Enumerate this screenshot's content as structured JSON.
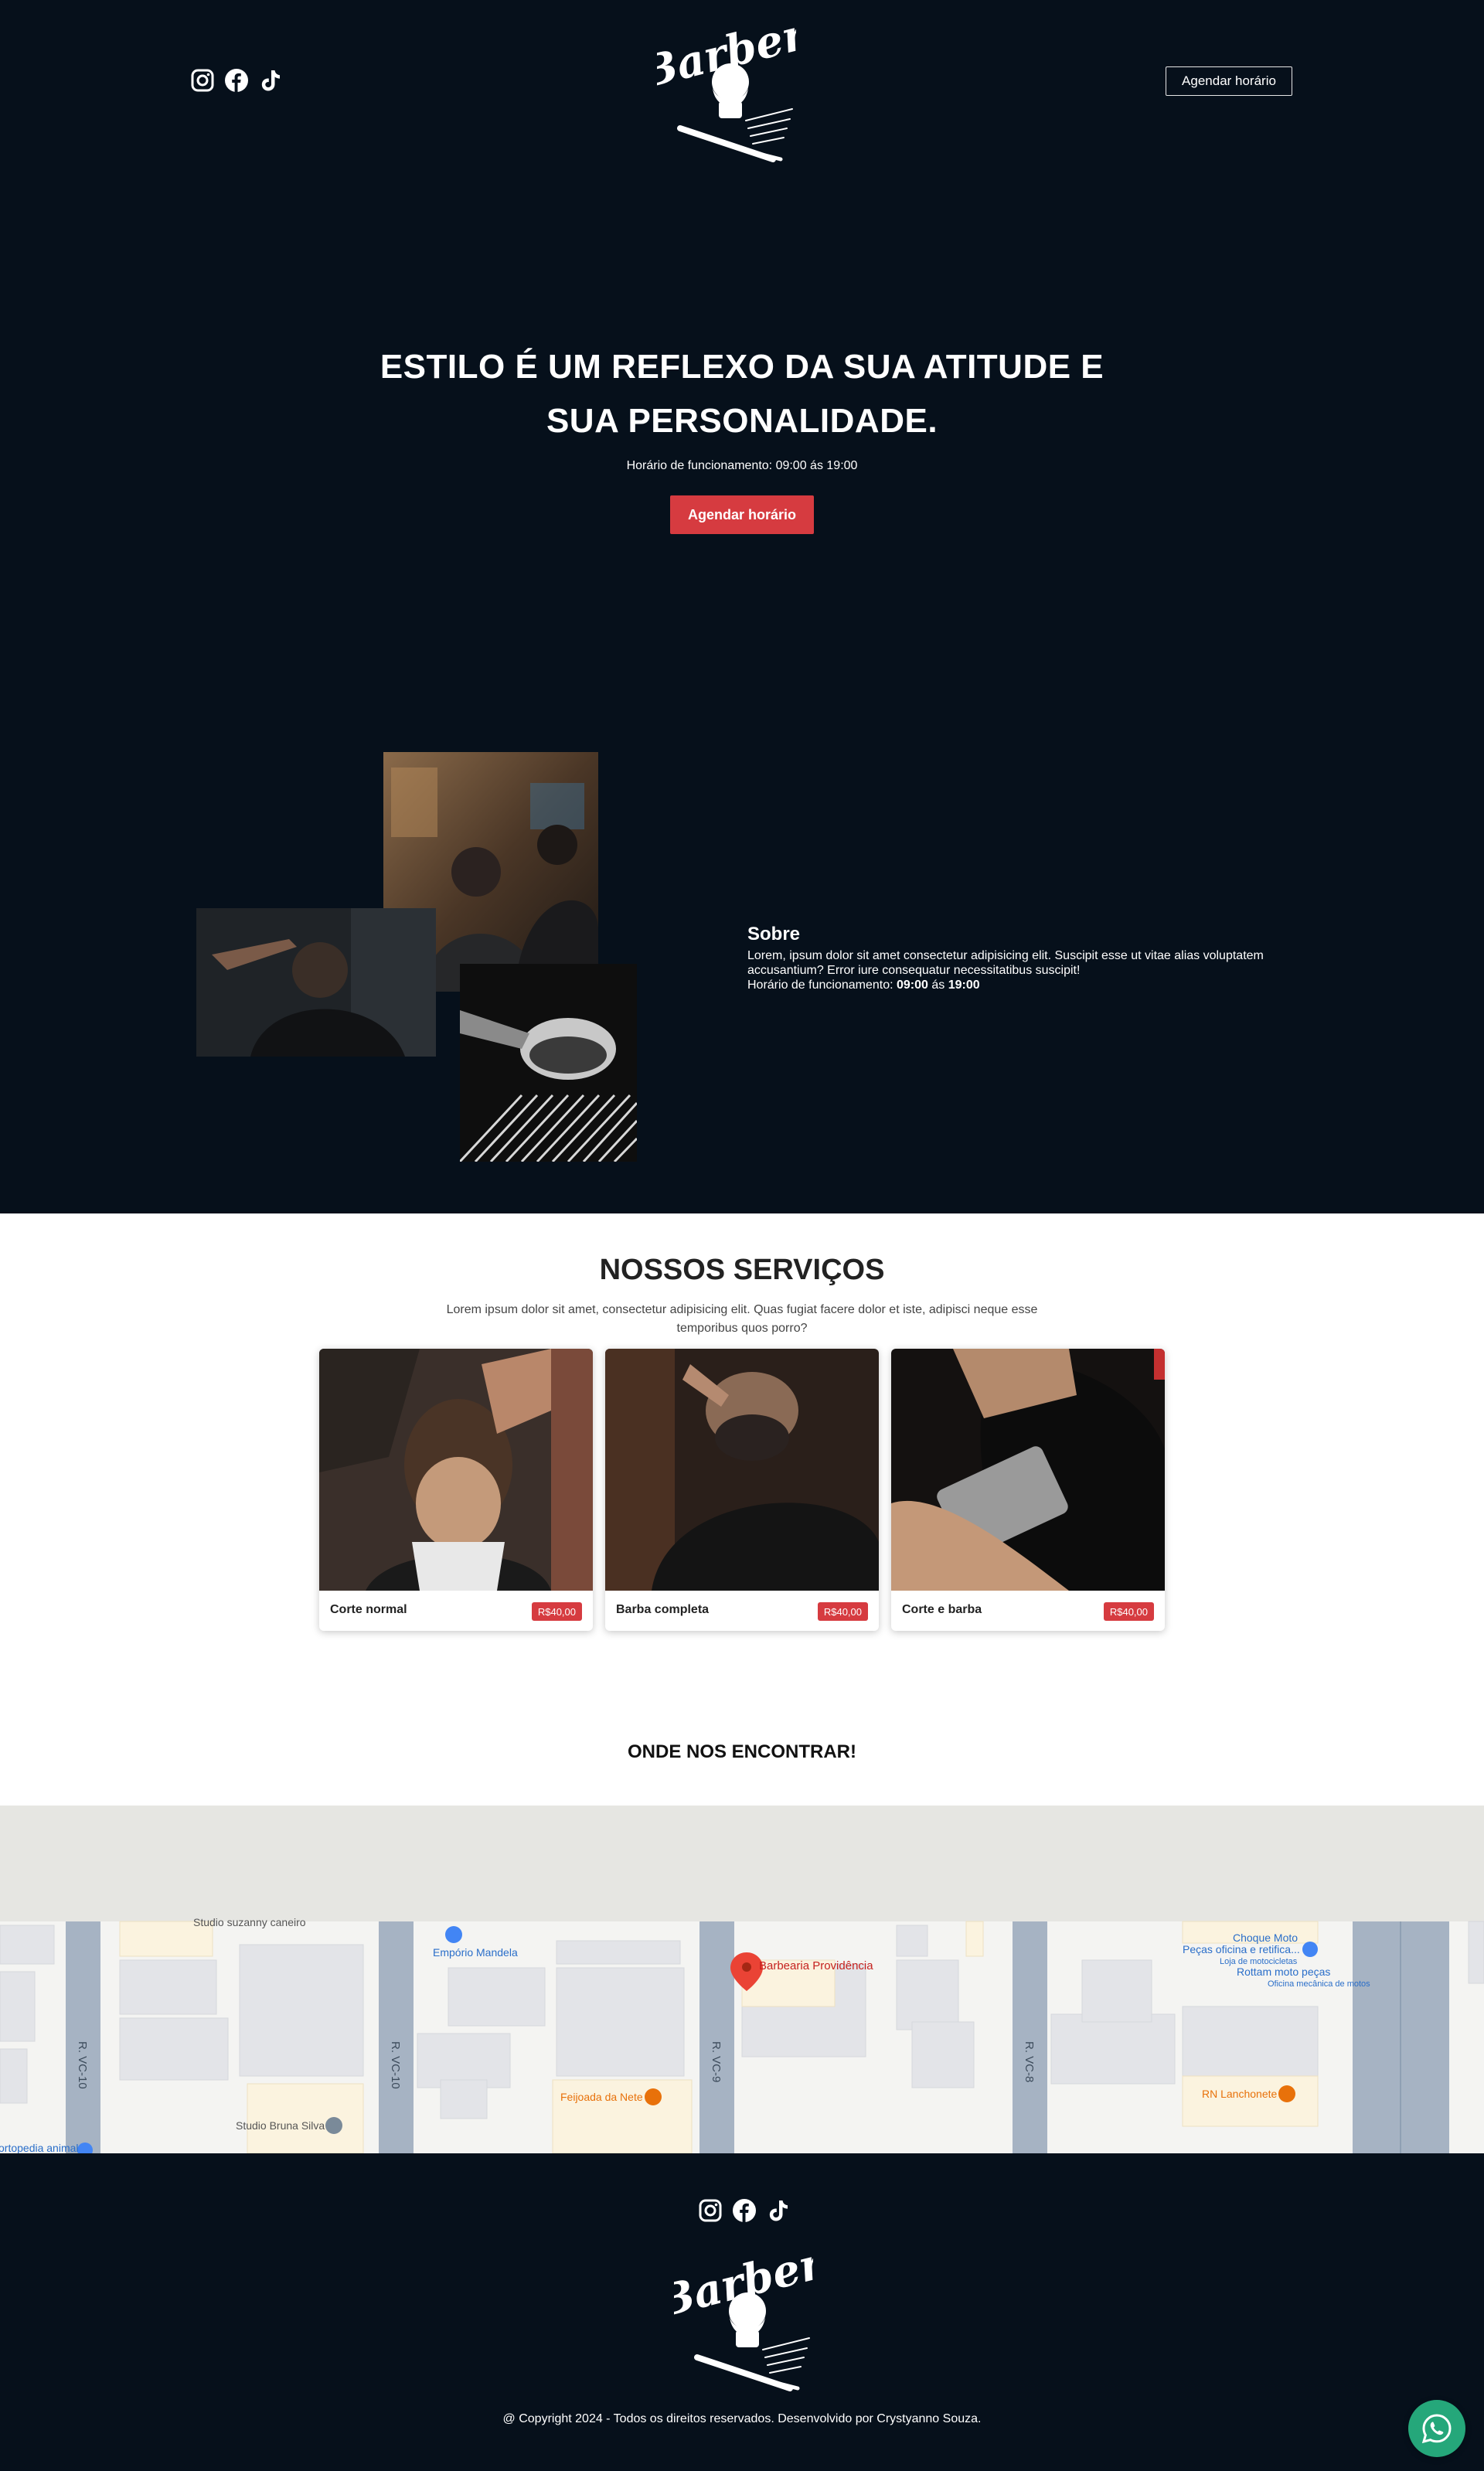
{
  "header": {
    "social_icons": [
      "instagram-icon",
      "facebook-icon",
      "tiktok-icon"
    ],
    "logo_text": "Barber",
    "cta_label": "Agendar horário"
  },
  "hero": {
    "title_line1": "ESTILO É UM REFLEXO DA SUA ATITUDE E",
    "title_line2": "SUA PERSONALIDADE.",
    "hours": "Horário de funcionamento: 09:00 ás 19:00",
    "cta_label": "Agendar horário"
  },
  "about": {
    "title": "Sobre",
    "body": "Lorem, ipsum dolor sit amet consectetur adipisicing elit. Suscipit esse ut vitae alias voluptatem accusantium? Error iure consequatur necessitatibus suscipit!",
    "hours_prefix": "Horário de funcionamento: ",
    "hours_open": "09:00",
    "hours_mid": " ás ",
    "hours_close": "19:00"
  },
  "services": {
    "title": "NOSSOS SERVIÇOS",
    "subtitle": "Lorem ipsum dolor sit amet, consectetur adipisicing elit. Quas fugiat facere dolor et iste, adipisci neque esse temporibus quos porro?",
    "items": [
      {
        "name": "Corte normal",
        "price": "R$40,00"
      },
      {
        "name": "Barba completa",
        "price": "R$40,00"
      },
      {
        "name": "Corte e barba",
        "price": "R$40,00"
      }
    ]
  },
  "location": {
    "title": "ONDE NOS ENCONTRAR!",
    "map": {
      "main_pin": "Barbearia Providência",
      "places": [
        "Studio suzanny caneiro",
        "Empório Mandela",
        "Feijoada da Nete",
        "Studio Bruna Silva",
        "ortopedia animal",
        "Choque Moto",
        "Peças oficina e retifica...",
        "Loja de motocicletas",
        "Rottam moto peças",
        "Oficina mecânica de motos",
        "RN Lanchonete"
      ],
      "streets": [
        "R. VC-10",
        "R. VC-10",
        "R. VC-9",
        "R. VC-8"
      ]
    }
  },
  "footer": {
    "social_icons": [
      "instagram-icon",
      "facebook-icon",
      "tiktok-icon"
    ],
    "logo_text": "Barber",
    "copyright": "@ Copyright 2024 - Todos os direitos reservados. Desenvolvido por Crystyanno Souza."
  },
  "colors": {
    "dark_bg": "#06101b",
    "accent_red": "#d63b40",
    "whatsapp_green": "#25a77a"
  }
}
